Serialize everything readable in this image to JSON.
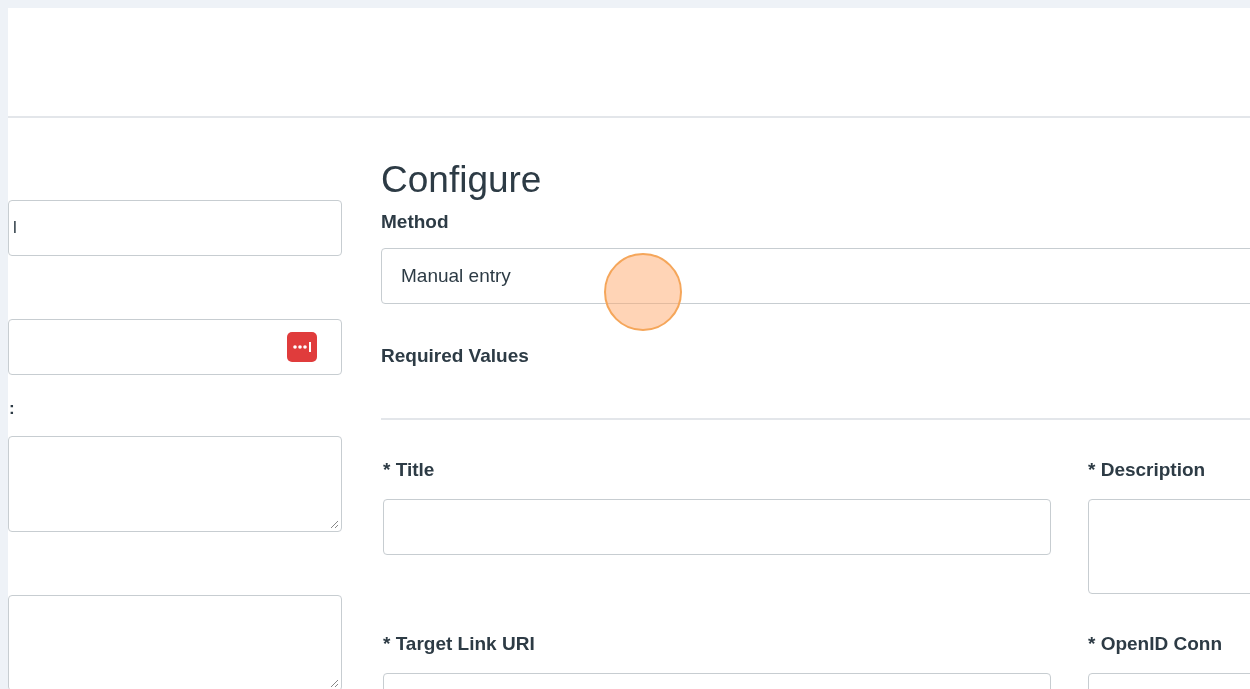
{
  "left_panel": {
    "fields": [
      {
        "kind": "input",
        "value": "l"
      },
      {
        "kind": "icon_input"
      },
      {
        "kind": "textarea",
        "label": ":"
      },
      {
        "kind": "textarea"
      }
    ]
  },
  "configure": {
    "heading": "Configure",
    "method": {
      "label": "Method",
      "value": "Manual entry"
    },
    "section": "Required Values",
    "fields": [
      {
        "label": "* Title",
        "kind": "input"
      },
      {
        "label": "* Description",
        "kind": "textarea"
      },
      {
        "label": "* Target Link URI",
        "kind": "input"
      },
      {
        "label": "* OpenID Conn",
        "kind": "input"
      }
    ]
  }
}
